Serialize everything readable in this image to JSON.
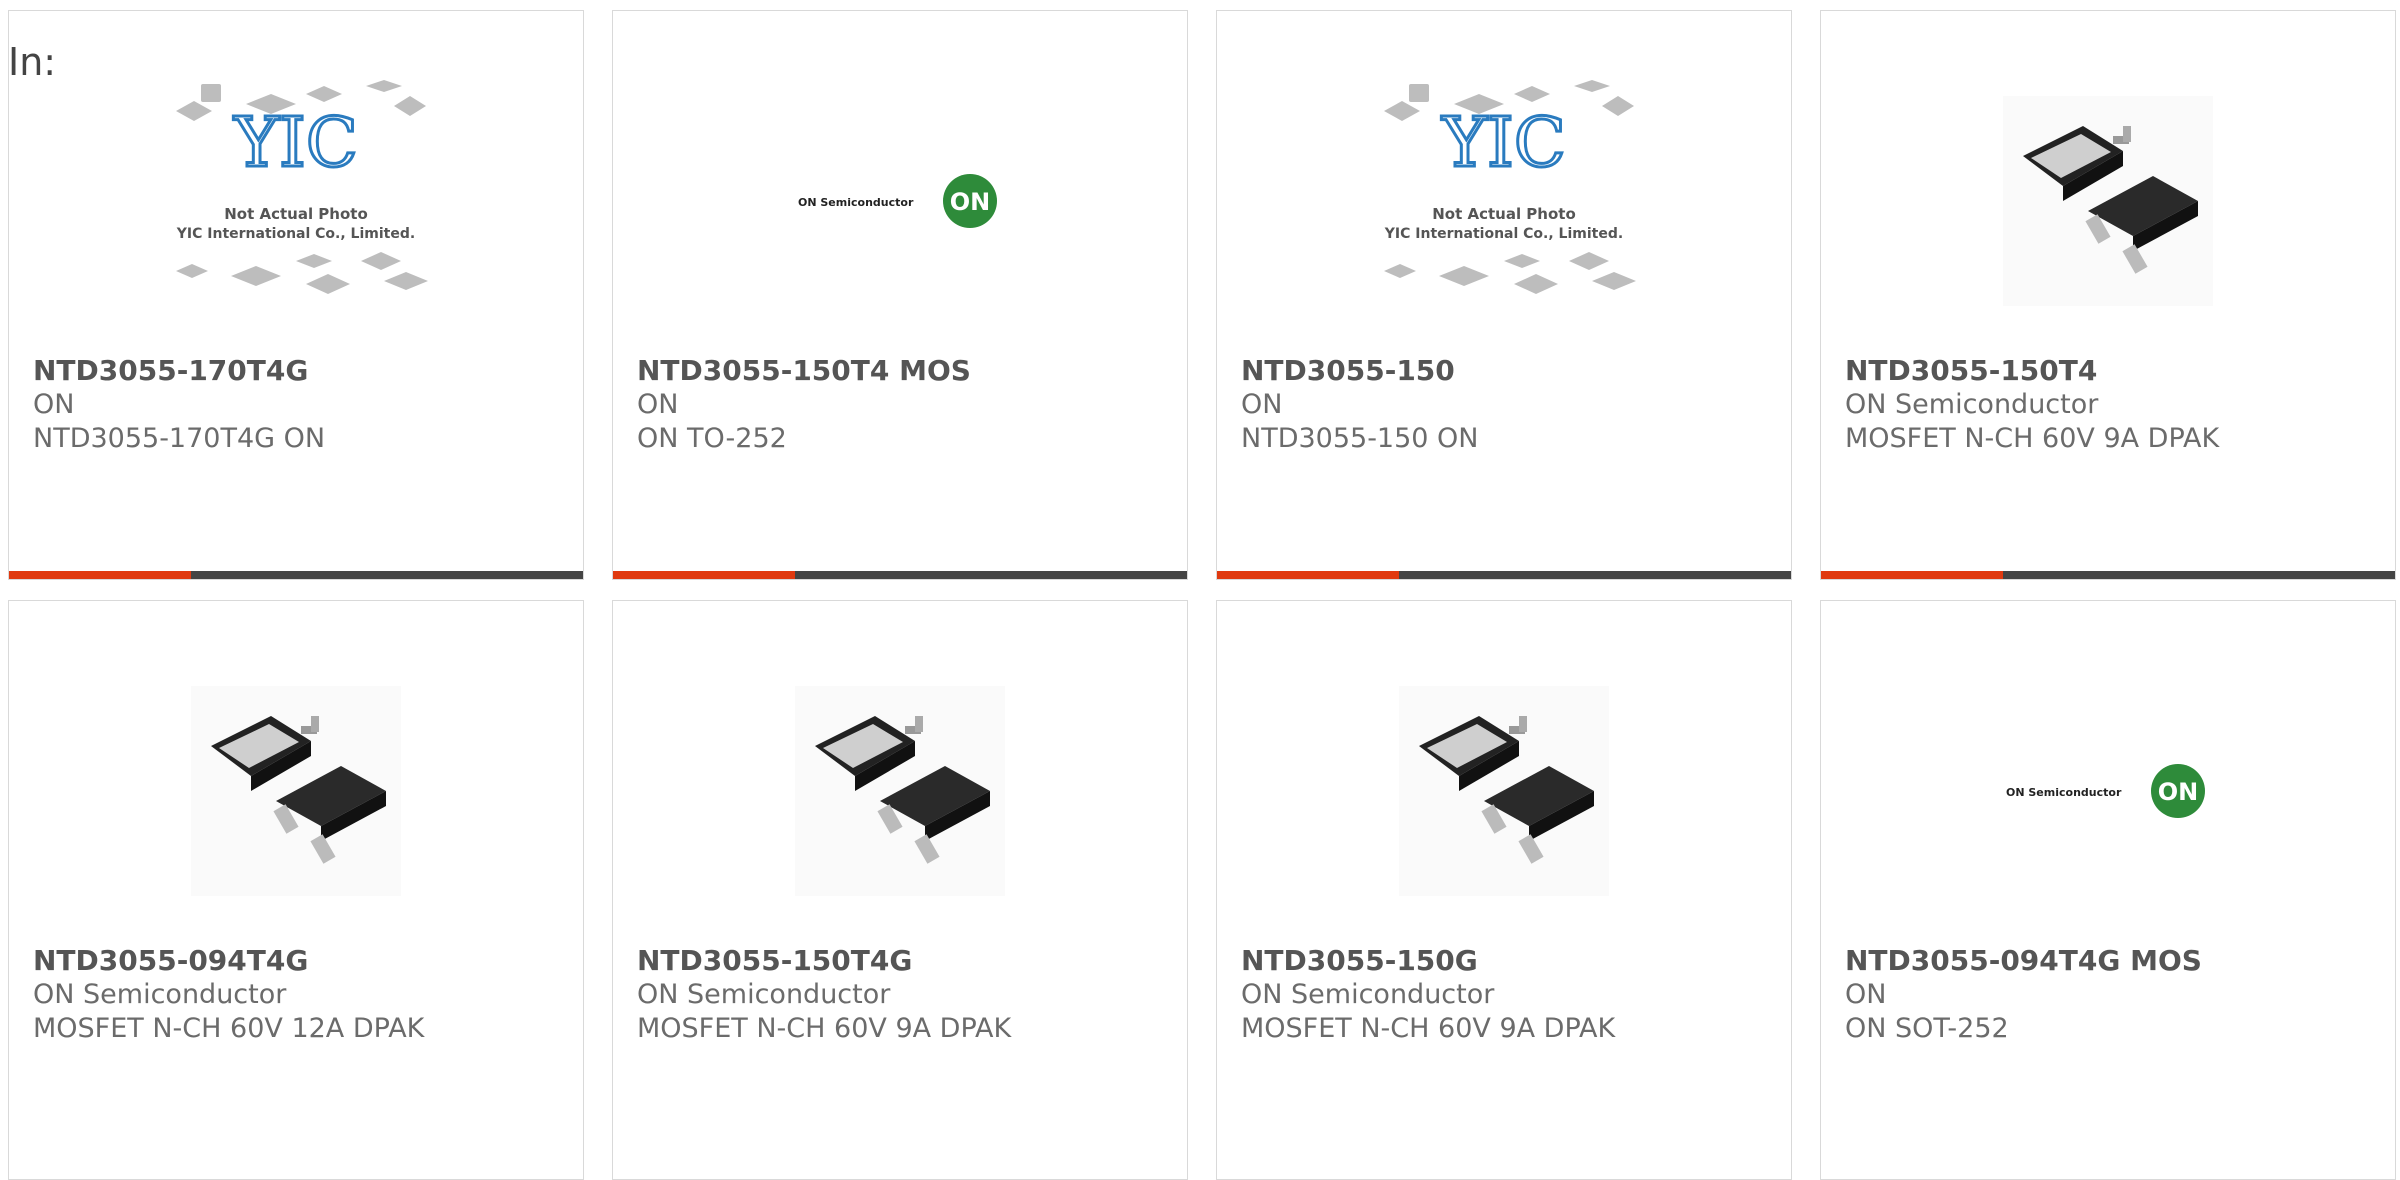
{
  "filter_label": "In:",
  "colors": {
    "accent": "#e03a10",
    "bar": "#444444",
    "border": "#d9d9d9"
  },
  "yic": {
    "line1": "Not Actual Photo",
    "line2": "YIC International Co., Limited.",
    "logo": "YIC"
  },
  "on_logo": {
    "text": "ON Semiconductor",
    "badge": "ON"
  },
  "products": [
    {
      "part": "NTD3055-170T4G",
      "maker": "ON",
      "desc": "NTD3055-170T4G ON",
      "image": "yic-placeholder"
    },
    {
      "part": "NTD3055-150T4 MOS",
      "maker": "ON",
      "desc": "ON TO-252",
      "image": "on-semiconductor-logo"
    },
    {
      "part": "NTD3055-150",
      "maker": "ON",
      "desc": "NTD3055-150 ON",
      "image": "yic-placeholder"
    },
    {
      "part": "NTD3055-150T4",
      "maker": "ON Semiconductor",
      "desc": "MOSFET N-CH 60V 9A DPAK",
      "image": "dpak-package"
    },
    {
      "part": "NTD3055-094T4G",
      "maker": "ON Semiconductor",
      "desc": "MOSFET N-CH 60V 12A DPAK",
      "image": "dpak-package"
    },
    {
      "part": "NTD3055-150T4G",
      "maker": "ON Semiconductor",
      "desc": "MOSFET N-CH 60V 9A DPAK",
      "image": "dpak-package"
    },
    {
      "part": "NTD3055-150G",
      "maker": "ON Semiconductor",
      "desc": "MOSFET N-CH 60V 9A DPAK",
      "image": "dpak-package"
    },
    {
      "part": "NTD3055-094T4G MOS",
      "maker": "ON",
      "desc": "ON SOT-252",
      "image": "on-semiconductor-logo"
    }
  ]
}
